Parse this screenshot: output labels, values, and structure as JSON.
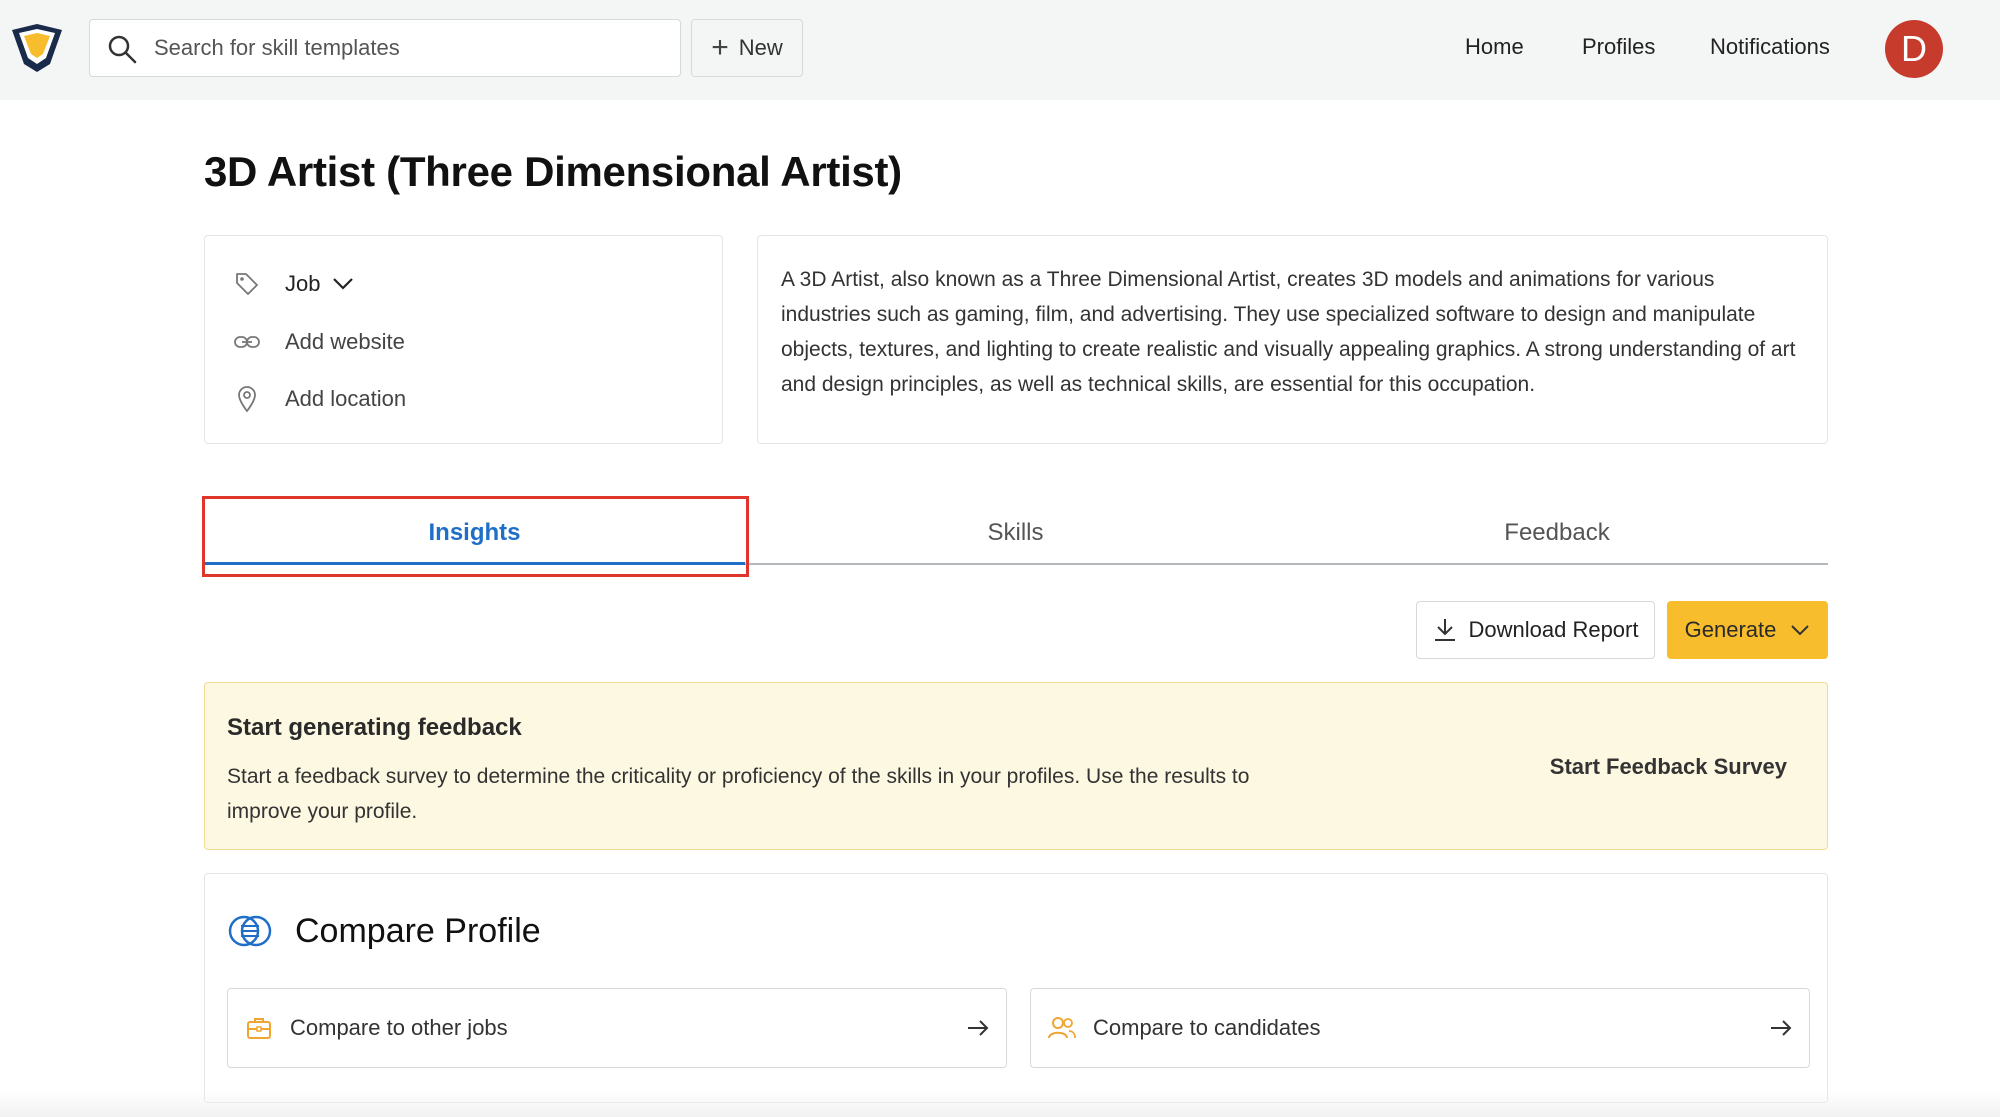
{
  "header": {
    "search_placeholder": "Search for skill templates",
    "new_label": "New",
    "nav": [
      "Home",
      "Profiles",
      "Notifications"
    ],
    "avatar_initial": "D"
  },
  "page": {
    "title": "3D Artist (Three Dimensional Artist)",
    "info": {
      "type_label": "Job",
      "website_label": "Add website",
      "location_label": "Add location"
    },
    "description": "A 3D Artist, also known as a Three Dimensional Artist, creates 3D models and animations for various industries such as gaming, film, and advertising. They use specialized software to design and manipulate objects, textures, and lighting to create realistic and visually appealing graphics. A strong understanding of art and design principles, as well as technical skills, are essential for this occupation."
  },
  "tabs": [
    "Insights",
    "Skills",
    "Feedback"
  ],
  "active_tab": "Insights",
  "actions": {
    "download_label": "Download Report",
    "generate_label": "Generate"
  },
  "banner": {
    "title": "Start generating feedback",
    "text": "Start a feedback survey to determine the criticality or proficiency of the skills in your profiles. Use the results to improve your profile.",
    "link": "Start Feedback Survey"
  },
  "compare": {
    "title": "Compare Profile",
    "options": [
      "Compare to other jobs",
      "Compare to candidates"
    ]
  },
  "colors": {
    "accent_blue": "#1f6fc9",
    "generate_yellow": "#f7bd2c",
    "highlight_red": "#e0352b",
    "avatar_red": "#c63b2b",
    "banner_bg": "#fdf8e1"
  }
}
